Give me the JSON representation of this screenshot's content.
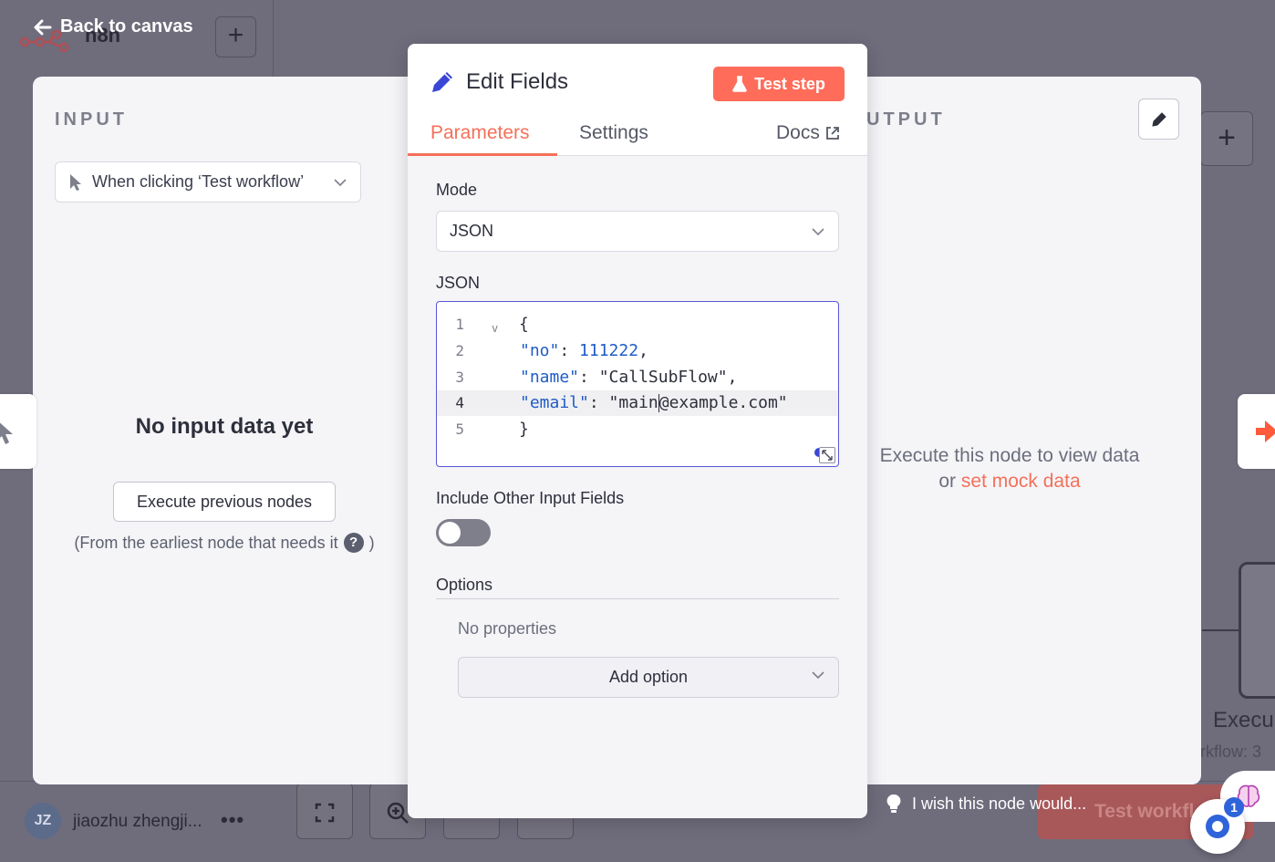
{
  "canvas": {
    "back_label": "Back to canvas",
    "workflow_name": "n8n",
    "add_label": "+",
    "right_node_title": "Execu",
    "right_node_subtitle": "rkflow: 3",
    "user_initials": "JZ",
    "user_name": "jiaozhu zhengji...",
    "user_menu": "•••",
    "test_workflow_label": "Test workfl",
    "feedback_label": "I wish this node would...",
    "chat_badge": "1"
  },
  "input_panel": {
    "title": "INPUT",
    "trigger_select": "When clicking ‘Test workflow’",
    "empty_title": "No input data yet",
    "execute_button": "Execute previous nodes",
    "hint": "(From the earliest node that needs it",
    "hint_close": ")"
  },
  "output_panel": {
    "title": "UTPUT",
    "hint_line1": "Execute this node to view data",
    "hint_prefix": "or",
    "mock_link": "set mock data"
  },
  "node": {
    "title": "Edit Fields",
    "test_step_label": "Test step",
    "tabs": [
      {
        "label": "Parameters",
        "active": true
      },
      {
        "label": "Settings",
        "active": false
      }
    ],
    "docs_label": "Docs",
    "mode_label": "Mode",
    "mode_value": "JSON",
    "json_label": "JSON",
    "json_lines": [
      {
        "num": "1",
        "text": "{"
      },
      {
        "num": "2",
        "key": "\"no\"",
        "sep": ": ",
        "value": "111222",
        "end": ","
      },
      {
        "num": "3",
        "key": "\"name\"",
        "sep": ": ",
        "value": "\"CallSubFlow\"",
        "end": ","
      },
      {
        "num": "4",
        "key": "\"email\"",
        "sep": ": ",
        "value_before_caret": "\"main",
        "value_after_caret": "@example.com\""
      },
      {
        "num": "5",
        "text": "}"
      }
    ],
    "fold_marker": "v",
    "include_label": "Include Other Input Fields",
    "include_enabled": false,
    "options_label": "Options",
    "no_properties": "No properties",
    "add_option_label": "Add option"
  },
  "colors": {
    "accent": "#ff6d5a",
    "link": "#f4705a",
    "editor_border": "#5a55d8",
    "json_token": "#1f5cc7"
  }
}
